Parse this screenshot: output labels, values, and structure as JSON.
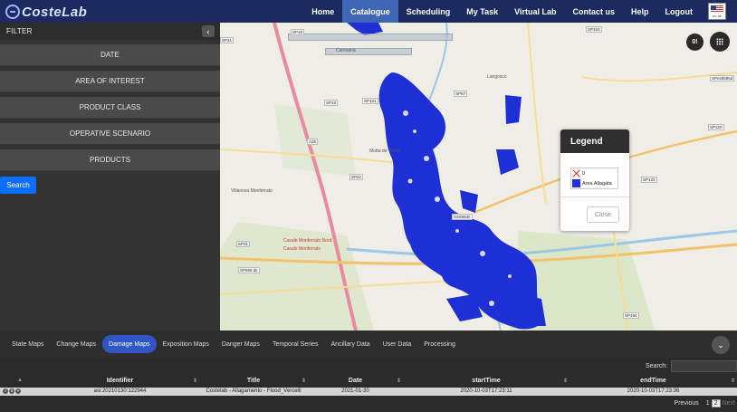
{
  "header": {
    "logo_text": "CosteLab",
    "nav": [
      "Home",
      "Catalogue",
      "Scheduling",
      "My Task",
      "Virtual Lab",
      "Contact us",
      "Help",
      "Logout"
    ],
    "active_nav": "Catalogue",
    "language_code": "en-uk"
  },
  "sidebar": {
    "filter_title": "FILTER",
    "filters": [
      "DATE",
      "AREA OF INTEREST",
      "PRODUCT CLASS",
      "OPERATIVE SCENARIO",
      "PRODUCTS"
    ],
    "search_label": "Search"
  },
  "map": {
    "notice_badge": "0!",
    "places": [
      "Caresana",
      "Langosco",
      "Motta de' Conti",
      "Villanova Monferrato",
      "Casale Monferrato Nord",
      "Casale Monferrato"
    ],
    "roads": [
      "SP18",
      "SP31",
      "SP23",
      "SP121",
      "SP87",
      "SP22",
      "SP153",
      "SP120",
      "SPex5596d",
      "SP133",
      "SP194",
      "SP596 dir",
      "SS596dir",
      "SP31",
      "A26"
    ],
    "flood_color": "#1f2fd6"
  },
  "legend": {
    "title": "Legend",
    "items": [
      {
        "label": "0",
        "symbol": "cross"
      },
      {
        "label": "Area Allagata",
        "symbol": "blue-square"
      }
    ],
    "close_label": "Close"
  },
  "tabs": {
    "items": [
      "State Maps",
      "Change Maps",
      "Damage Maps",
      "Exposition Maps",
      "Danger Maps",
      "Temporal Series",
      "Ancillary Data",
      "User Data",
      "Processing"
    ],
    "active": "Damage Maps"
  },
  "table": {
    "search_label": "Search:",
    "columns": [
      "Identifier",
      "Title",
      "Date",
      "startTime",
      "endTime"
    ],
    "rows": [
      {
        "identifier": "asi:20210130:122944",
        "title": "Costelab - Allagamento - Flood_Vercelli",
        "date": "2021-01-30",
        "start": "2020-10-03T17:23:11",
        "end": "2020-10-03T17:23:36"
      }
    ],
    "pager": {
      "previous": "Previous",
      "pages": [
        "1",
        "2"
      ],
      "current": "2",
      "next": "Next"
    }
  }
}
